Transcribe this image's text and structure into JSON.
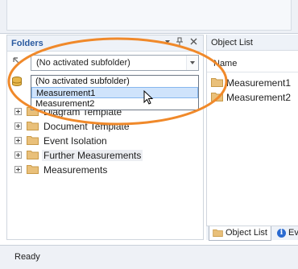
{
  "folders_panel": {
    "title": "Folders",
    "combo_value": "(No activated subfolder)",
    "dropdown_options": [
      "(No activated subfolder)",
      "Measurement1",
      "Measurement2"
    ],
    "highlighted_option": "Measurement1",
    "tree_items": [
      {
        "label": "Diagram Template"
      },
      {
        "label": "Document Template"
      },
      {
        "label": "Event Isolation"
      },
      {
        "label": "Further Measurements"
      },
      {
        "label": "Measurements"
      }
    ]
  },
  "object_panel": {
    "title": "Object List",
    "column_name": "Name",
    "rows": [
      "Measurement1",
      "Measurement2"
    ],
    "tabs": [
      "Object List",
      "Ev"
    ]
  },
  "status_bar": {
    "text": "Ready"
  },
  "colors": {
    "accent_ring": "#f0892a",
    "selection": "#cfe3fb",
    "header_text": "#2a5aa0"
  },
  "icons": [
    "pin-icon",
    "close-icon",
    "back-arrow-icon",
    "database-icon",
    "folder-icon",
    "info-icon",
    "cursor-icon"
  ]
}
